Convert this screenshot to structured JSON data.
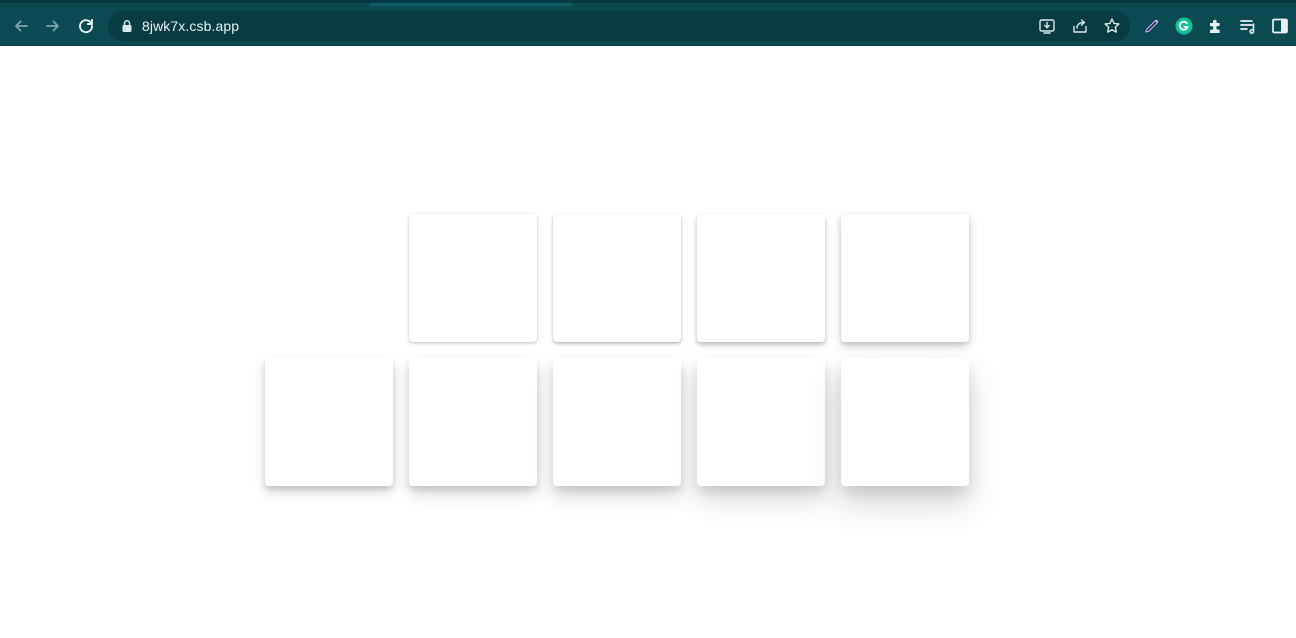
{
  "browser": {
    "url": "8jwk7x.csb.app",
    "colors": {
      "toolbar": "#0b4a52",
      "omnibox": "#083c43",
      "icon": "#dbe7e8",
      "icon_dim": "#7fa6ab",
      "grammarly": "#15c39a"
    },
    "icons": [
      "back-arrow-icon",
      "forward-arrow-icon",
      "reload-icon",
      "lock-icon",
      "install-app-icon",
      "share-icon",
      "bookmark-star-icon",
      "pen-extension-icon",
      "grammarly-icon",
      "extensions-puzzle-icon",
      "reading-list-icon",
      "side-panel-icon"
    ]
  },
  "page": {
    "cards": [
      {
        "id": "card-1",
        "row": 1
      },
      {
        "id": "card-2",
        "row": 1
      },
      {
        "id": "card-3",
        "row": 1
      },
      {
        "id": "card-4",
        "row": 1
      },
      {
        "id": "card-5",
        "row": 2
      },
      {
        "id": "card-6",
        "row": 2
      },
      {
        "id": "card-7",
        "row": 2
      },
      {
        "id": "card-8",
        "row": 2
      },
      {
        "id": "card-9",
        "row": 2
      }
    ]
  }
}
